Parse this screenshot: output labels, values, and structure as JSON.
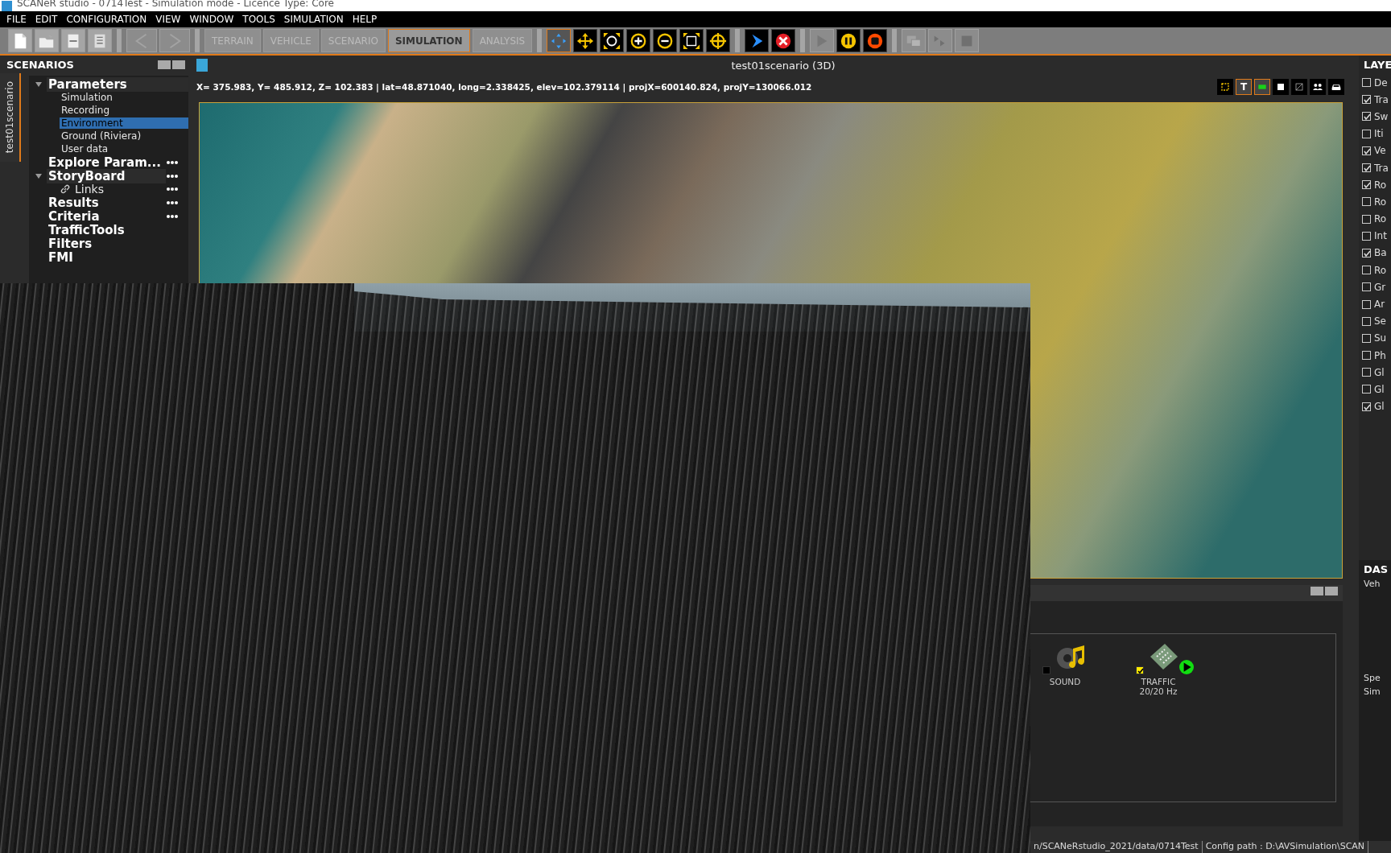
{
  "window": {
    "title": "SCANeR studio - 0714Test - Simulation mode - Licence Type: Core"
  },
  "menu": [
    "FILE",
    "EDIT",
    "CONFIGURATION",
    "VIEW",
    "WINDOW",
    "TOOLS",
    "SIMULATION",
    "HELP"
  ],
  "toolbar": {
    "file_buttons": [
      {
        "kind": "new",
        "disabled": false
      },
      {
        "kind": "open",
        "disabled": false
      },
      {
        "kind": "save",
        "disabled": false
      },
      {
        "kind": "document",
        "disabled": false
      },
      {
        "kind": "back",
        "disabled": true
      },
      {
        "kind": "forward",
        "disabled": true
      }
    ],
    "modes": [
      {
        "label": "TERRAIN",
        "selected": false
      },
      {
        "label": "VEHICLE",
        "selected": false
      },
      {
        "label": "SCENARIO",
        "selected": false
      },
      {
        "label": "SIMULATION",
        "selected": true
      },
      {
        "label": "ANALYSIS",
        "selected": false
      }
    ],
    "tools": [
      {
        "kind": "select",
        "selected": true,
        "disabled": false
      },
      {
        "kind": "pan",
        "selected": false,
        "disabled": false
      },
      {
        "kind": "zoom-region",
        "selected": false,
        "disabled": false
      },
      {
        "kind": "zoom-in",
        "selected": false,
        "disabled": false
      },
      {
        "kind": "zoom-out",
        "selected": false,
        "disabled": false
      },
      {
        "kind": "fit",
        "selected": false,
        "disabled": false
      },
      {
        "kind": "target",
        "selected": false,
        "disabled": false
      },
      {
        "kind": "start",
        "selected": false,
        "disabled": false
      },
      {
        "kind": "abort",
        "selected": false,
        "disabled": false
      },
      {
        "kind": "play",
        "selected": false,
        "disabled": true
      },
      {
        "kind": "pause",
        "selected": false,
        "disabled": false
      },
      {
        "kind": "stop",
        "selected": false,
        "disabled": false
      },
      {
        "kind": "capture",
        "selected": false,
        "disabled": true
      },
      {
        "kind": "step",
        "selected": false,
        "disabled": true
      },
      {
        "kind": "square",
        "selected": false,
        "disabled": true
      }
    ]
  },
  "scenarios_panel": {
    "title": "SCENARIOS",
    "tab": "test01scenario",
    "tree": [
      {
        "label": "Parameters",
        "expanded": true,
        "menu": false,
        "children": [
          {
            "label": "Simulation",
            "selected": false
          },
          {
            "label": "Recording",
            "selected": false
          },
          {
            "label": "Environment",
            "selected": true
          },
          {
            "label": "Ground (Riviera)",
            "selected": false
          },
          {
            "label": "User data",
            "selected": false
          }
        ]
      },
      {
        "label": "Explore Param...",
        "menu": true
      },
      {
        "label": "StoryBoard",
        "expanded": true,
        "menu": true,
        "children": [
          {
            "label": "Links",
            "selected": false,
            "link": true,
            "menu": true
          }
        ]
      },
      {
        "label": "Results",
        "menu": true
      },
      {
        "label": "Criteria",
        "menu": true
      },
      {
        "label": "TrafficTools",
        "menu": false
      },
      {
        "label": "Filters",
        "menu": false
      },
      {
        "label": "FMI",
        "menu": false
      }
    ]
  },
  "view": {
    "title": "test01scenario (3D)",
    "coordinates": "X= 375.983, Y= 485.912, Z= 102.383 | lat=48.871040, long=2.338425, elev=102.379114 | projX=600140.824, projY=130066.012",
    "view_buttons": [
      {
        "kind": "frame",
        "selected": false
      },
      {
        "kind": "text",
        "label": "T",
        "selected": true
      },
      {
        "kind": "green",
        "selected": true
      },
      {
        "kind": "white",
        "selected": false
      },
      {
        "kind": "diagonal",
        "selected": false
      },
      {
        "kind": "people",
        "selected": false
      },
      {
        "kind": "car",
        "selected": false
      }
    ]
  },
  "layers": {
    "title": "LAYE",
    "items": [
      {
        "label": "De",
        "checked": false
      },
      {
        "label": "Tra",
        "checked": true
      },
      {
        "label": "Sw",
        "checked": true
      },
      {
        "label": "Iti",
        "checked": false
      },
      {
        "label": "Ve",
        "checked": true
      },
      {
        "label": "Tra",
        "checked": true
      },
      {
        "label": "Ro",
        "checked": true
      },
      {
        "label": "Ro",
        "checked": false
      },
      {
        "label": "Ro",
        "checked": false
      },
      {
        "label": "Int",
        "checked": false
      },
      {
        "label": "Ba",
        "checked": true
      },
      {
        "label": "Ro",
        "checked": false
      },
      {
        "label": "Gr",
        "checked": false
      },
      {
        "label": "Ar",
        "checked": false
      },
      {
        "label": "Se",
        "checked": false
      },
      {
        "label": "Su",
        "checked": false
      },
      {
        "label": "Ph",
        "checked": false
      },
      {
        "label": "Gl",
        "checked": false
      },
      {
        "label": "Gl",
        "checked": false
      },
      {
        "label": "Gl",
        "checked": true
      }
    ]
  },
  "modules": [
    {
      "kind": "sound",
      "label": "SOUND",
      "checked": false,
      "running": false
    },
    {
      "kind": "traffic",
      "label": "TRAFFIC",
      "rate": "20/20 Hz",
      "checked": true,
      "running": true
    }
  ],
  "dashboard": {
    "title": "DAS",
    "labels": [
      "Veh",
      "Spe",
      "Sim"
    ]
  },
  "status_bar": [
    "n/SCANeRstudio_2021/data/0714Test",
    "Config path : D:\\AVSimulation\\SCAN"
  ]
}
